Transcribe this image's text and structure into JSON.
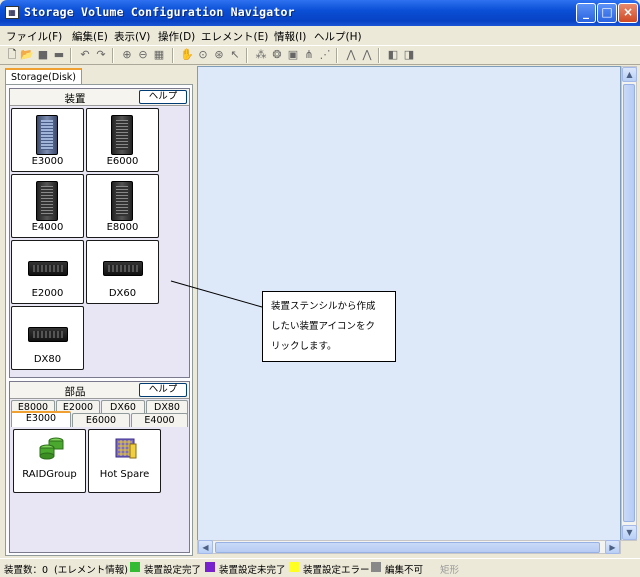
{
  "window": {
    "title": "Storage Volume Configuration Navigator"
  },
  "menu": [
    "ファイル(F)",
    "編集(E)",
    "表示(V)",
    "操作(D)",
    "エレメント(E)",
    "情報(I)",
    "ヘルプ(H)"
  ],
  "tab": {
    "label": "Storage(Disk)"
  },
  "devices": {
    "title": "装置",
    "help_label": "ヘルプ",
    "items": [
      {
        "label": "E3000",
        "icon": "tower-light-icon"
      },
      {
        "label": "E6000",
        "icon": "tower-dark-icon"
      },
      {
        "label": "E4000",
        "icon": "tower-dark-icon"
      },
      {
        "label": "E8000",
        "icon": "tower-dark-icon"
      },
      {
        "label": "E2000",
        "icon": "rack-unit-icon"
      },
      {
        "label": "DX60",
        "icon": "rack-unit-icon"
      },
      {
        "label": "DX80",
        "icon": "rack-unit-icon"
      }
    ]
  },
  "parts": {
    "title": "部品",
    "help_label": "ヘルプ",
    "tabs_back": [
      "E8000",
      "E2000",
      "DX60",
      "DX80"
    ],
    "tabs_front": [
      "E3000",
      "E6000",
      "E4000"
    ],
    "active_tab": "E3000",
    "items": [
      {
        "label": "RAIDGroup",
        "icon": "raid-group-icon"
      },
      {
        "label": "Hot Spare",
        "icon": "hot-spare-icon"
      }
    ]
  },
  "callout": {
    "text": "装置ステンシルから作成\nしたい装置アイコンをク\nリックします。"
  },
  "status": {
    "count": "装置数：0",
    "info": "(エレメント情報)",
    "legend": [
      {
        "label": "装置設定完了",
        "color": "#33bb33"
      },
      {
        "label": "装置設定未完了",
        "color": "#7722cc"
      },
      {
        "label": "装置設定エラー",
        "color": "#ffff22"
      },
      {
        "label": "編集不可",
        "color": "#888888"
      }
    ],
    "shape": "矩形"
  }
}
